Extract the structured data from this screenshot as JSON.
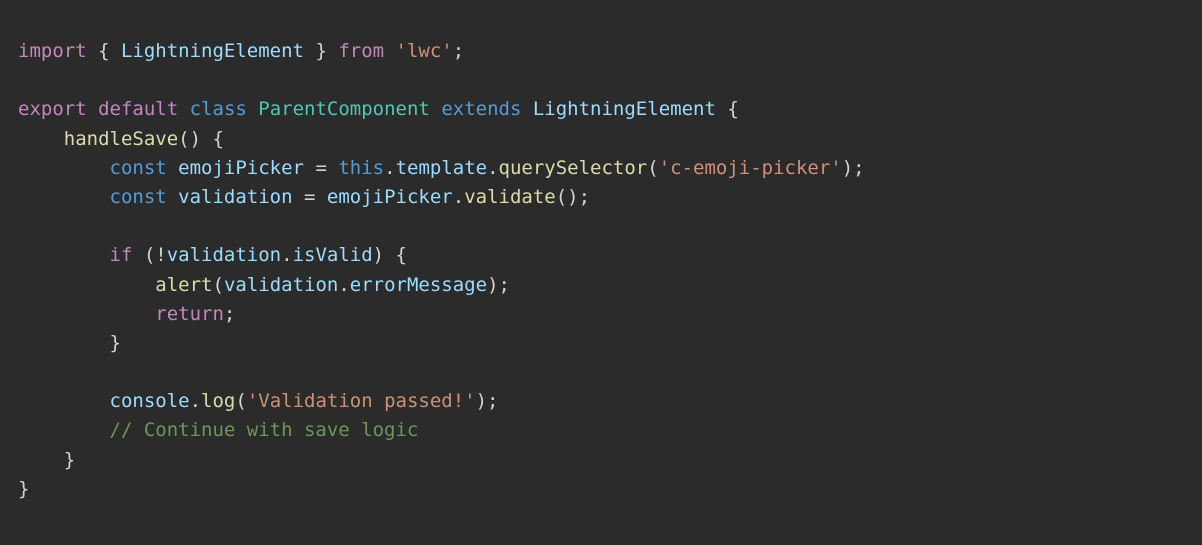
{
  "colors": {
    "background": "#2b2b2b",
    "default": "#d4d4d4",
    "keyword_control": "#c586c0",
    "keyword_storage": "#569cd6",
    "class_name": "#4ec9b0",
    "variable": "#9cdcfe",
    "function": "#dcdcaa",
    "string": "#ce9178",
    "comment": "#6a9955"
  },
  "code": {
    "language": "javascript",
    "lines": [
      [
        {
          "t": "import",
          "c": "keyword_control"
        },
        {
          "t": " { ",
          "c": "default"
        },
        {
          "t": "LightningElement",
          "c": "variable"
        },
        {
          "t": " } ",
          "c": "default"
        },
        {
          "t": "from",
          "c": "keyword_control"
        },
        {
          "t": " ",
          "c": "default"
        },
        {
          "t": "'lwc'",
          "c": "string"
        },
        {
          "t": ";",
          "c": "default"
        }
      ],
      [],
      [
        {
          "t": "export",
          "c": "keyword_control"
        },
        {
          "t": " ",
          "c": "default"
        },
        {
          "t": "default",
          "c": "keyword_control"
        },
        {
          "t": " ",
          "c": "default"
        },
        {
          "t": "class",
          "c": "keyword_storage"
        },
        {
          "t": " ",
          "c": "default"
        },
        {
          "t": "ParentComponent",
          "c": "class_name"
        },
        {
          "t": " ",
          "c": "default"
        },
        {
          "t": "extends",
          "c": "keyword_storage"
        },
        {
          "t": " ",
          "c": "default"
        },
        {
          "t": "LightningElement",
          "c": "variable"
        },
        {
          "t": " {",
          "c": "default"
        }
      ],
      [
        {
          "t": "    ",
          "c": "default"
        },
        {
          "t": "handleSave",
          "c": "function"
        },
        {
          "t": "() {",
          "c": "default"
        }
      ],
      [
        {
          "t": "        ",
          "c": "default"
        },
        {
          "t": "const",
          "c": "keyword_storage"
        },
        {
          "t": " ",
          "c": "default"
        },
        {
          "t": "emojiPicker",
          "c": "variable"
        },
        {
          "t": " = ",
          "c": "default"
        },
        {
          "t": "this",
          "c": "keyword_storage"
        },
        {
          "t": ".",
          "c": "default"
        },
        {
          "t": "template",
          "c": "variable"
        },
        {
          "t": ".",
          "c": "default"
        },
        {
          "t": "querySelector",
          "c": "function"
        },
        {
          "t": "(",
          "c": "default"
        },
        {
          "t": "'c-emoji-picker'",
          "c": "string"
        },
        {
          "t": ");",
          "c": "default"
        }
      ],
      [
        {
          "t": "        ",
          "c": "default"
        },
        {
          "t": "const",
          "c": "keyword_storage"
        },
        {
          "t": " ",
          "c": "default"
        },
        {
          "t": "validation",
          "c": "variable"
        },
        {
          "t": " = ",
          "c": "default"
        },
        {
          "t": "emojiPicker",
          "c": "variable"
        },
        {
          "t": ".",
          "c": "default"
        },
        {
          "t": "validate",
          "c": "function"
        },
        {
          "t": "();",
          "c": "default"
        }
      ],
      [],
      [
        {
          "t": "        ",
          "c": "default"
        },
        {
          "t": "if",
          "c": "keyword_control"
        },
        {
          "t": " (!",
          "c": "default"
        },
        {
          "t": "validation",
          "c": "variable"
        },
        {
          "t": ".",
          "c": "default"
        },
        {
          "t": "isValid",
          "c": "variable"
        },
        {
          "t": ") {",
          "c": "default"
        }
      ],
      [
        {
          "t": "            ",
          "c": "default"
        },
        {
          "t": "alert",
          "c": "function"
        },
        {
          "t": "(",
          "c": "default"
        },
        {
          "t": "validation",
          "c": "variable"
        },
        {
          "t": ".",
          "c": "default"
        },
        {
          "t": "errorMessage",
          "c": "variable"
        },
        {
          "t": ");",
          "c": "default"
        }
      ],
      [
        {
          "t": "            ",
          "c": "default"
        },
        {
          "t": "return",
          "c": "keyword_control"
        },
        {
          "t": ";",
          "c": "default"
        }
      ],
      [
        {
          "t": "        }",
          "c": "default"
        }
      ],
      [],
      [
        {
          "t": "        ",
          "c": "default"
        },
        {
          "t": "console",
          "c": "variable"
        },
        {
          "t": ".",
          "c": "default"
        },
        {
          "t": "log",
          "c": "function"
        },
        {
          "t": "(",
          "c": "default"
        },
        {
          "t": "'Validation passed!'",
          "c": "string"
        },
        {
          "t": ");",
          "c": "default"
        }
      ],
      [
        {
          "t": "        ",
          "c": "default"
        },
        {
          "t": "// Continue with save logic",
          "c": "comment"
        }
      ],
      [
        {
          "t": "    }",
          "c": "default"
        }
      ],
      [
        {
          "t": "}",
          "c": "default"
        }
      ]
    ]
  }
}
